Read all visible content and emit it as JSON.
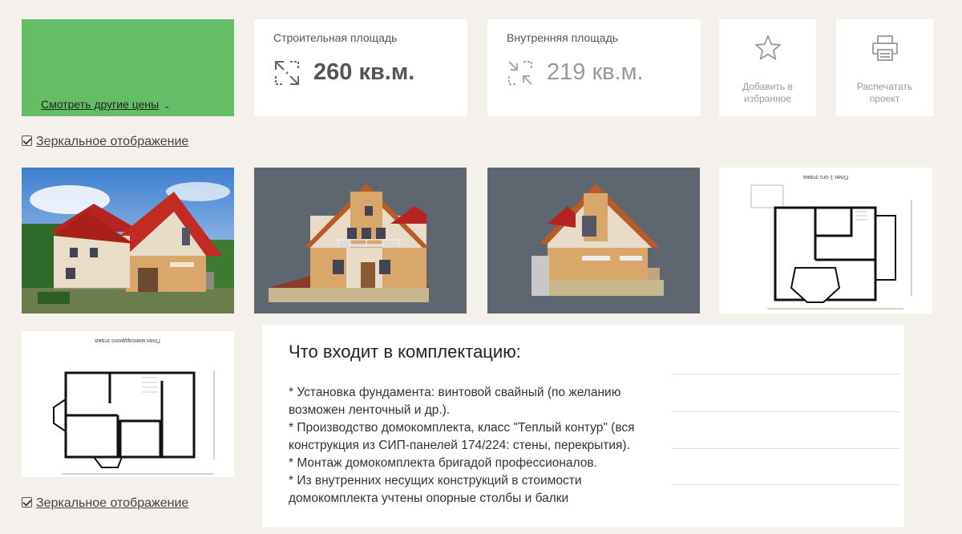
{
  "price": {
    "other_prices_link": "Смотреть другие цены"
  },
  "building_area": {
    "label": "Строительная площадь",
    "value": "260 кв.м.",
    "icon": "expand-arrows-icon"
  },
  "inner_area": {
    "label": "Внутренняя площадь",
    "value": "219 кв.м.",
    "icon": "collapse-arrows-icon"
  },
  "actions": {
    "favorite": {
      "label": "Добавить в избранное",
      "icon": "star-icon"
    },
    "print": {
      "label": "Распечатать проект",
      "icon": "printer-icon"
    }
  },
  "mirror_label": "Зеркальное отображение",
  "plans": {
    "first_floor_title": "План 1-ого этажа",
    "attic_title": "План мансардного этажа"
  },
  "contents": {
    "title": "Что входит в комплектацию:",
    "items": [
      "* Установка фундамента: винтовой свайный (по желанию возможен ленточный и др.).",
      "* Производство домокомплекта, класс \"Теплый контур\" (вся конструкция из СИП-панелей 174/224: стены, перекрытия).",
      "* Монтаж домокомплекта бригадой профессионалов.",
      "* Из внутренних несущих конструкций в стоимости домокомплекта учтены опорные столбы и балки"
    ]
  },
  "colors": {
    "price_bg": "#64be66",
    "page_bg": "#f4f1ec",
    "roof": "#b52420",
    "wood": "#d9a76a"
  }
}
